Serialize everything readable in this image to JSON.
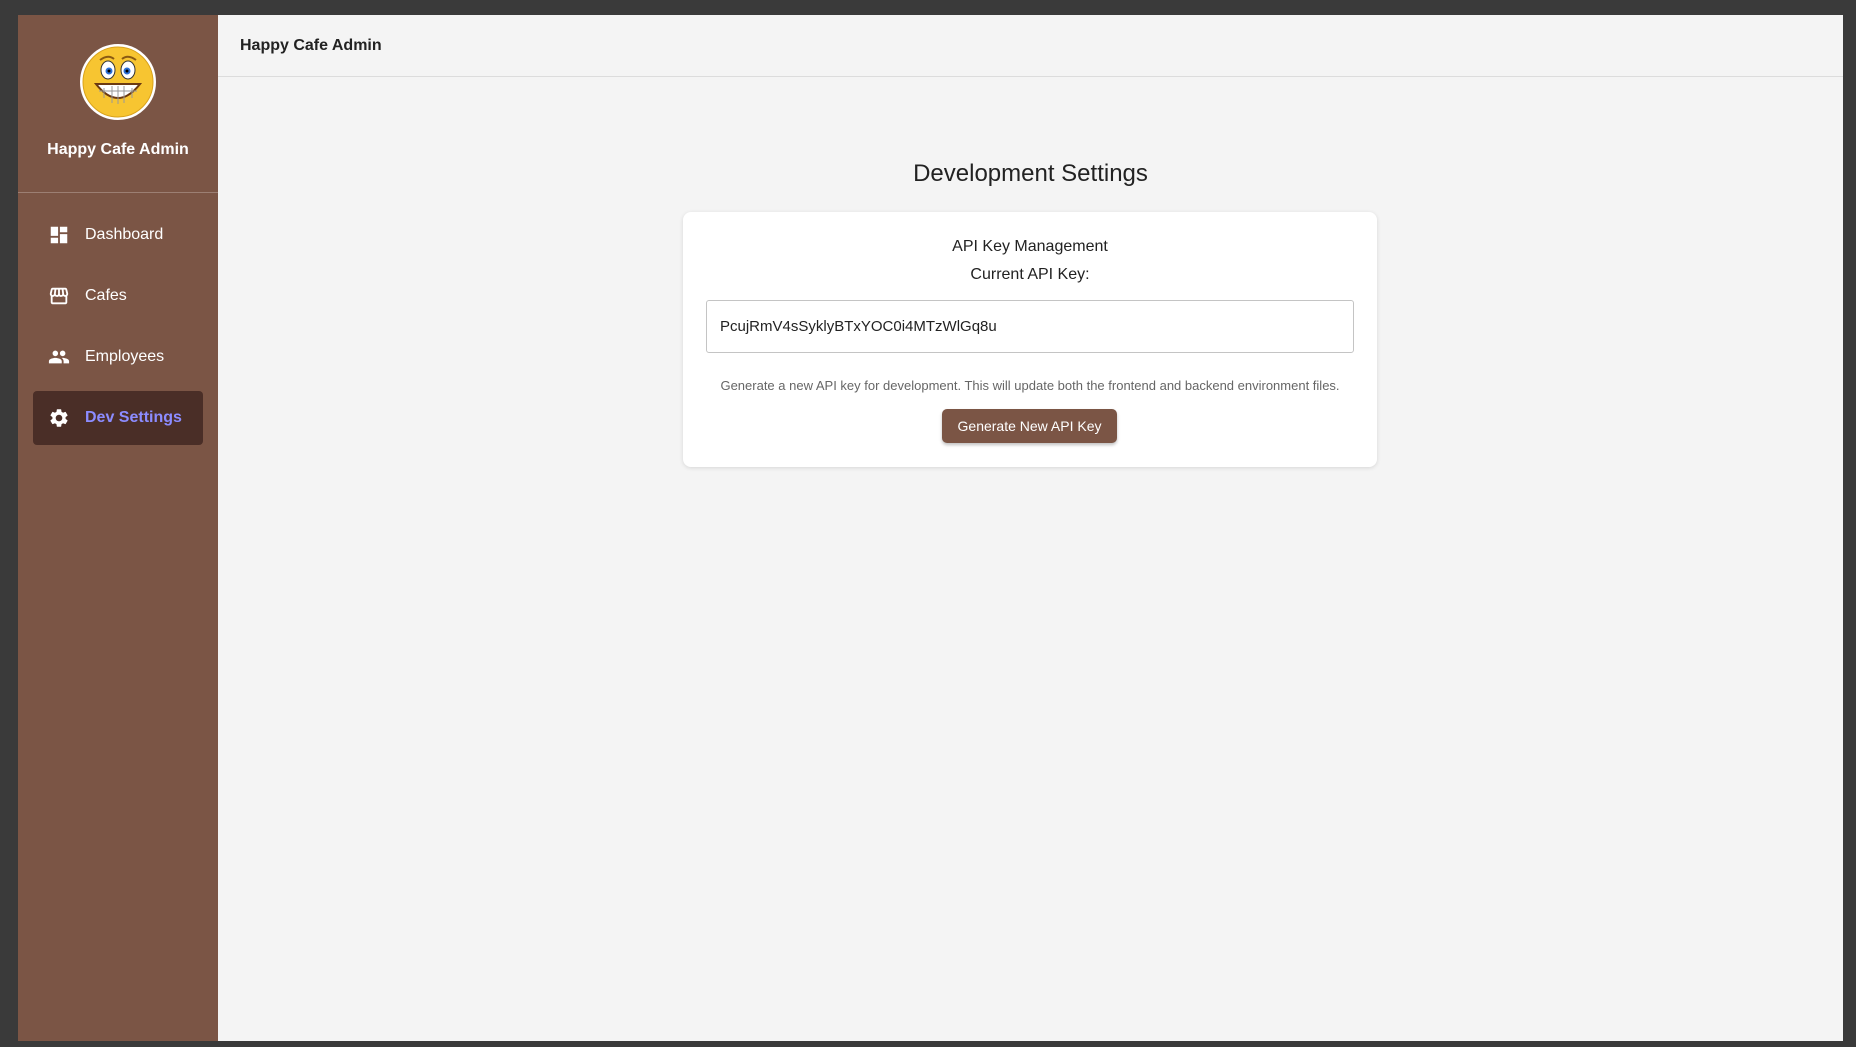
{
  "app": {
    "name": "Happy Cafe Admin",
    "topbar_title": "Happy Cafe Admin"
  },
  "sidebar": {
    "items": [
      {
        "label": "Dashboard",
        "icon": "dashboard-icon",
        "active": false
      },
      {
        "label": "Cafes",
        "icon": "storefront-icon",
        "active": false
      },
      {
        "label": "Employees",
        "icon": "people-icon",
        "active": false
      },
      {
        "label": "Dev Settings",
        "icon": "gear-icon",
        "active": true
      }
    ]
  },
  "main": {
    "title": "Development Settings",
    "card": {
      "heading": "API Key Management",
      "current_label": "Current API Key:",
      "api_key_value": "PcujRmV4sSyklyBTxYOC0i4MTzWlGq8u",
      "help_text": "Generate a new API key for development. This will update both the frontend and backend environment files.",
      "generate_button": "Generate New API Key"
    }
  },
  "colors": {
    "sidebar_bg": "#7b5545",
    "active_item_bg": "#4a2e27",
    "active_item_text": "#8c8cff",
    "button_bg": "#7b5545",
    "page_bg": "#f4f4f4"
  }
}
